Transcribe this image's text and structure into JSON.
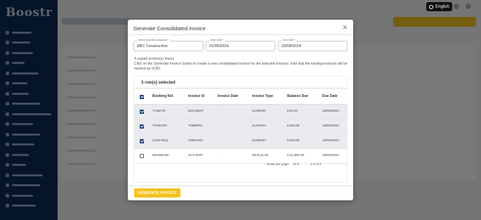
{
  "header": {
    "language_label": "English"
  },
  "modal": {
    "title": "Generate Consolidated Invoice",
    "customer": {
      "label": "Select business customer *",
      "value": "ABC Construction"
    },
    "start_date": {
      "label": "Start Date *",
      "value": "01/06/2024"
    },
    "end_date": {
      "label": "End Date *",
      "value": "29/08/2024"
    },
    "info_line1": "4 unpaid invoice(s) found.",
    "info_line2": "Click on the 'Generate Invoice' button to create a new consolidated invoice for the selected invoices. note that the existing invoices will be marked as VOID.",
    "selected_count": "3 row(s) selected",
    "columns": [
      "Booking Ref.",
      "Invoice Id",
      "Invoice Date",
      "Invoice Type",
      "Balance Due",
      "Due Date"
    ],
    "rows": [
      {
        "selected": true,
        "cells": [
          "7A9D7I0",
          "B2CWQIT",
          "-",
          "SUNDRY",
          "£10.00",
          "18/09/2024"
        ]
      },
      {
        "selected": true,
        "cells": [
          "TP60CP6",
          "T068FR5",
          "-",
          "SUNDRY",
          "£220.00",
          "18/09/2024"
        ]
      },
      {
        "selected": true,
        "cells": [
          "LXZFHEQ",
          "O36K3X0",
          "-",
          "SUNDRY",
          "£100.00",
          "18/09/2024"
        ]
      },
      {
        "selected": false,
        "cells": [
          "8O4ME4W",
          "SCFJ64P",
          "-",
          "REGULAR",
          "£13,380.00",
          "26/09/2024"
        ]
      }
    ],
    "pagination": {
      "rows_per_page_label": "Rows per page:",
      "rows_per_page": "10",
      "range": "1-4 of 4"
    },
    "generate_button": "GENERATE INVOICE"
  },
  "icons": {
    "close": "close-icon",
    "language": "globe-icon",
    "dropdown": "chevron-down-icon",
    "prev": "chevron-left-icon",
    "next": "chevron-right-icon"
  },
  "colors": {
    "accent_yellow": "#f3c21f",
    "sidebar_navy": "#0b2a55",
    "checkbox_navy": "#1c3d6e"
  }
}
